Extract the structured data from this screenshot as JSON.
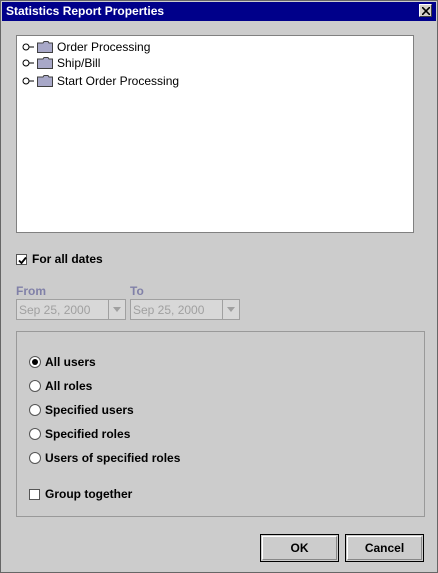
{
  "window": {
    "title": "Statistics Report Properties"
  },
  "tree": {
    "items": [
      {
        "label": "Order Processing"
      },
      {
        "label": "Ship/Bill"
      },
      {
        "label": "Start Order Processing"
      }
    ]
  },
  "for_all_dates": {
    "label": "For all dates",
    "checked": true
  },
  "date_range": {
    "from_label": "From",
    "to_label": "To",
    "from_value": "Sep 25, 2000",
    "to_value": "Sep 25, 2000",
    "enabled": false
  },
  "users": {
    "options": [
      {
        "label": "All users",
        "selected": true
      },
      {
        "label": "All roles",
        "selected": false
      },
      {
        "label": "Specified users",
        "selected": false
      },
      {
        "label": "Specified roles",
        "selected": false
      },
      {
        "label": "Users of specified roles",
        "selected": false
      }
    ],
    "group_together": {
      "label": "Group together",
      "checked": false
    }
  },
  "buttons": {
    "ok": "OK",
    "cancel": "Cancel"
  }
}
